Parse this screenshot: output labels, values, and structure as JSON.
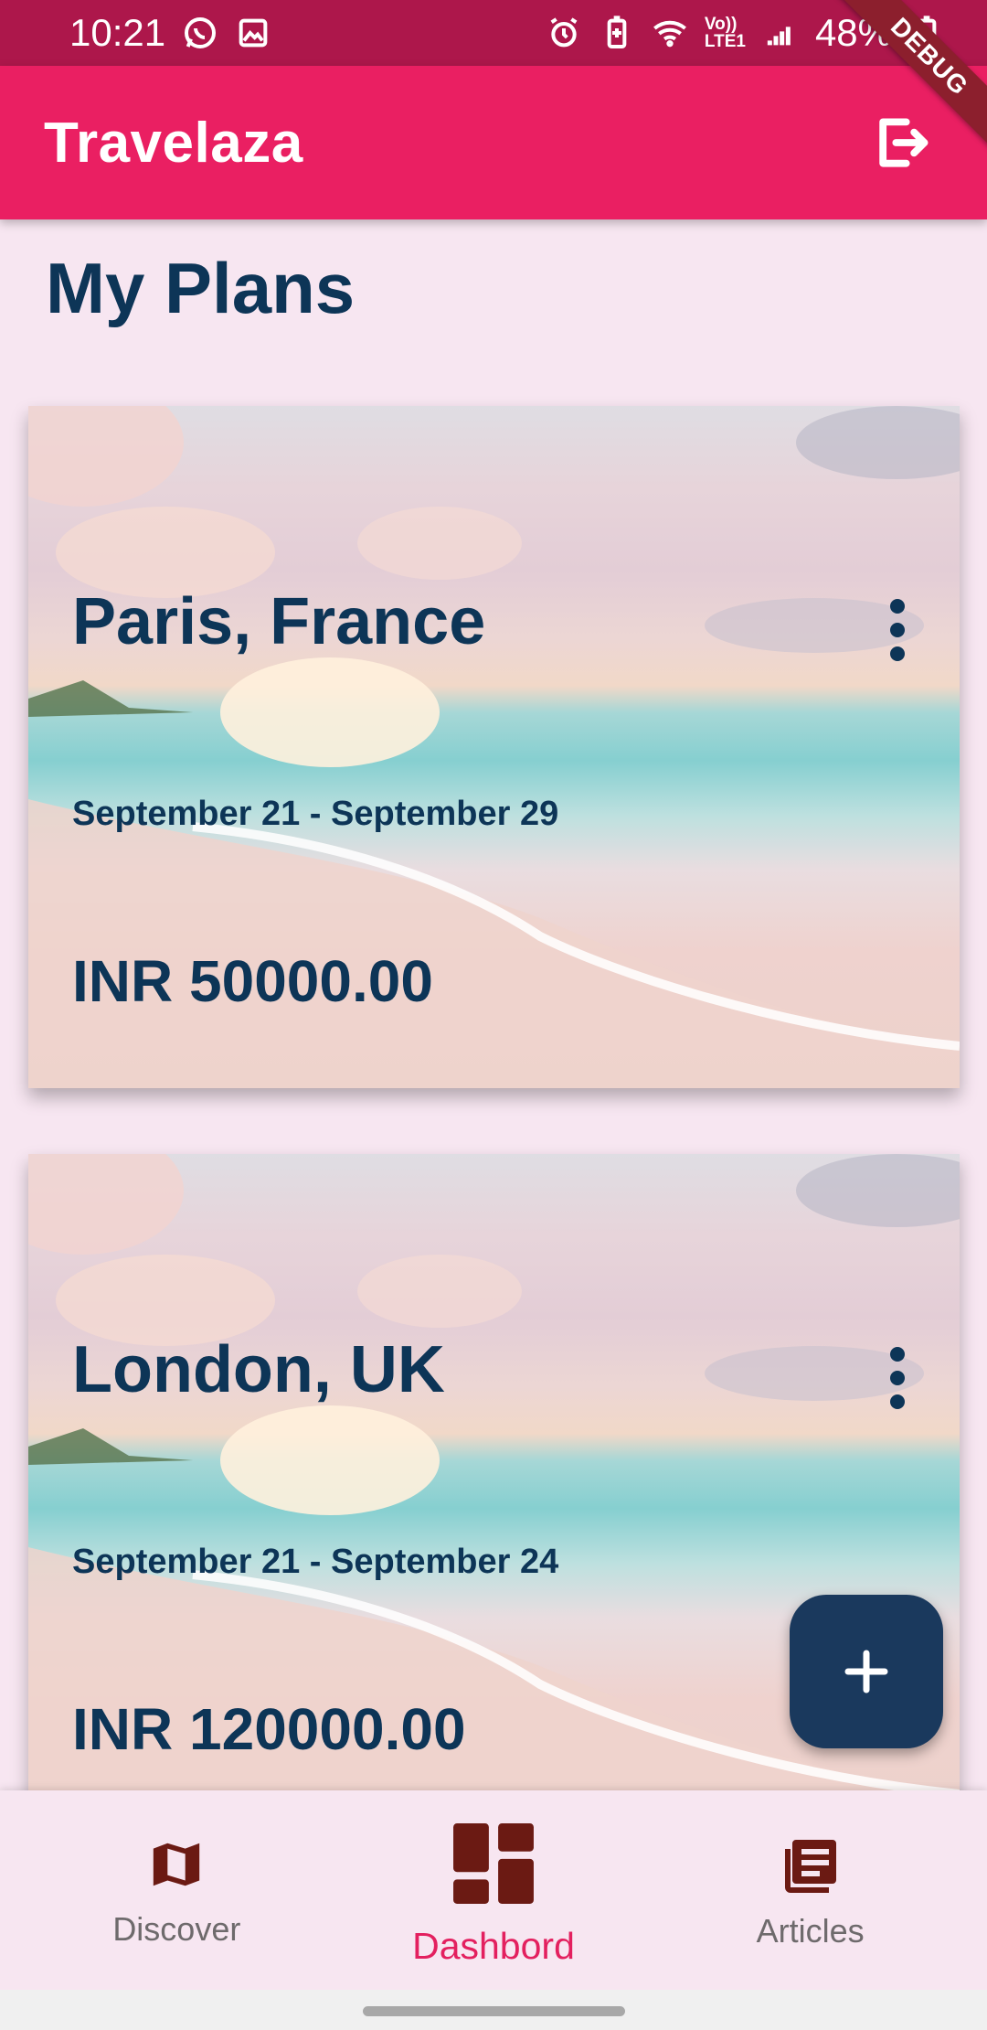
{
  "status_bar": {
    "time": "10:21",
    "left_icons": [
      "whatsapp-icon",
      "image-icon"
    ],
    "right_icons": [
      "alarm-icon",
      "battery-saver-icon",
      "wifi-icon",
      "volte-icon",
      "signal-icon",
      "battery-icon"
    ],
    "volte_label": "Vo))",
    "lte_label": "LTE1",
    "battery_percent": "48%"
  },
  "debug_banner": "DEBUG",
  "app_bar": {
    "title": "Travelaza",
    "logout_icon": "logout-icon"
  },
  "page": {
    "title": "My Plans"
  },
  "plans": [
    {
      "destination": "Paris, France",
      "dates": "September 21 - September 29",
      "budget": "INR 50000.00"
    },
    {
      "destination": "London, UK",
      "dates": "September 21 - September 24",
      "budget": "INR 120000.00"
    }
  ],
  "fab": {
    "icon": "add-icon"
  },
  "bottom_nav": {
    "items": [
      {
        "label": "Discover",
        "icon": "map-icon",
        "active": false
      },
      {
        "label": "Dashbord",
        "icon": "dashboard-icon",
        "active": true
      },
      {
        "label": "Articles",
        "icon": "articles-icon",
        "active": false
      }
    ]
  },
  "colors": {
    "status_bar": "#ad174b",
    "app_bar": "#ea1f62",
    "primary_text": "#0d3557",
    "fab": "#1a395d",
    "nav_active": "#e3205f",
    "nav_icon": "#6b1a13",
    "background": "#f7e6f1"
  }
}
